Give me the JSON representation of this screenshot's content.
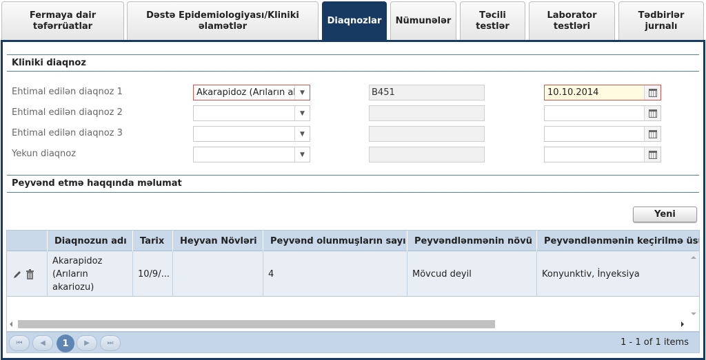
{
  "tabs": [
    {
      "label1": "Fermaya dair",
      "label2": "təfərrüatlar"
    },
    {
      "label1": "Dəstə Epidemiologiyası/Kliniki",
      "label2": "əlamətlər"
    },
    {
      "label1": "Diaqnozlar",
      "label2": ""
    },
    {
      "label1": "Nümunələr",
      "label2": ""
    },
    {
      "label1": "Təcili",
      "label2": "testlər"
    },
    {
      "label1": "Laborator",
      "label2": "testləri"
    },
    {
      "label1": "Tədbirlər",
      "label2": "jurnalı"
    }
  ],
  "clinical": {
    "title": "Kliniki diaqnoz",
    "rows": [
      {
        "label": "Ehtimal edilən diaqnoz 1",
        "diagnosis": "Akarapidoz (Arıların akariozu)",
        "code": "B451",
        "date": "10.10.2014"
      },
      {
        "label": "Ehtimal edilən diaqnoz 2",
        "diagnosis": "",
        "code": "",
        "date": ""
      },
      {
        "label": "Ehtimal edilən diaqnoz 3",
        "diagnosis": "",
        "code": "",
        "date": ""
      },
      {
        "label": "Yekun diaqnoz",
        "diagnosis": "",
        "code": "",
        "date": ""
      }
    ]
  },
  "vaccination": {
    "title": "Peyvənd etmə haqqında məlumat",
    "new_button": "Yeni",
    "columns": [
      "Diaqnozun adı",
      "Tarix",
      "Heyvan Növləri",
      "Peyvənd olunmuşların sayı",
      "Peyvəndlənmənin növü",
      "Peyvəndlənmənin keçirilmə üsulu"
    ],
    "rows": [
      {
        "diagnosis": "Akarapidoz (Arıların akariozu)",
        "date": "10/9/...",
        "species": "",
        "count": "4",
        "type": "Mövcud deyil",
        "method": "Konyunktiv, İnyeksiya"
      }
    ]
  },
  "pager": {
    "current": "1",
    "info": "1 - 1 of 1 items"
  },
  "icons": {
    "edit": "pencil-icon",
    "delete": "trash-icon",
    "calendar": "calendar-icon",
    "dropdown": "chevron-down-icon"
  },
  "colors": {
    "navy": "#173a63",
    "header": "#c9d9ea",
    "error_border": "#d9534f"
  }
}
